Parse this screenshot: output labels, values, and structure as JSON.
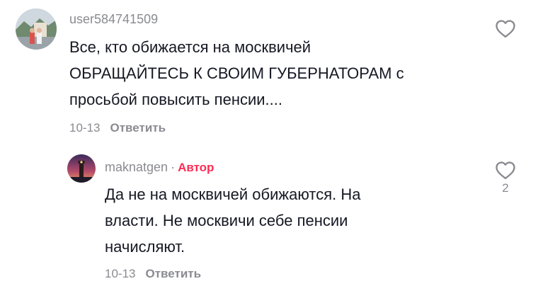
{
  "comments": [
    {
      "username": "user584741509",
      "text_lines": [
        "Все, кто обижается на москвичей",
        "ОБРАЩАЙТЕСЬ К СВОИМ ГУБЕРНАТОРАМ с",
        "просьбой повысить пенсии...."
      ],
      "date": "10-13",
      "reply_label": "Ответить",
      "like_icon": "heart-outline-icon"
    },
    {
      "username": "maknatgen",
      "separator": "·",
      "author_badge": "Автор",
      "text_lines": [
        "Да не на москвичей обижаются. На",
        "власти. Не москвичи себе пенсии",
        "начисляют."
      ],
      "date": "10-13",
      "reply_label": "Ответить",
      "like_icon": "heart-outline-icon",
      "like_count": "2"
    }
  ],
  "colors": {
    "muted_text": "#8a8b91",
    "author_badge": "#fe2c55",
    "primary_text": "#161823"
  }
}
